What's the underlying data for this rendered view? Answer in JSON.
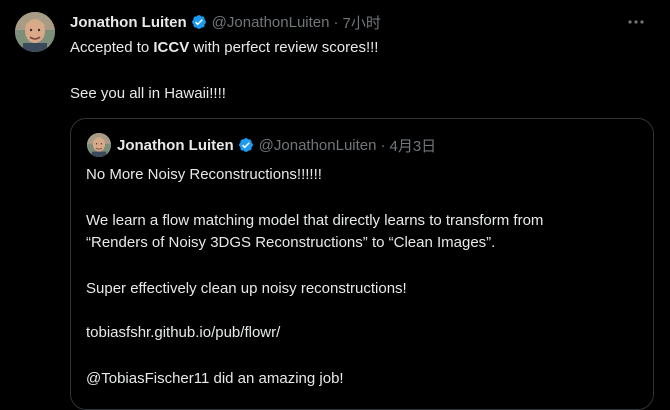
{
  "author": {
    "name": "Jonathon Luiten",
    "handle": "@JonathonLuiten",
    "time": "7小时"
  },
  "post": {
    "line1_before": "Accepted to ",
    "line1_bold": "ICCV",
    "line1_after": " with perfect review scores!!!",
    "line2": "See you all in Hawaii!!!!"
  },
  "quoted": {
    "name": "Jonathon Luiten",
    "handle": "@JonathonLuiten",
    "date": "4月3日",
    "lines": [
      "No More Noisy Reconstructions!!!!!!",
      "We learn a flow matching model that directly learns to transform from",
      "“Renders of Noisy 3DGS Reconstructions” to “Clean Images”.",
      "Super effectively clean up noisy reconstructions!",
      "tobiasfshr.github.io/pub/flowr/",
      "@TobiasFischer11 did an amazing job!"
    ]
  },
  "icons": {
    "verified": "verified-badge-icon",
    "more": "more-options-icon"
  },
  "colors": {
    "background": "#000000",
    "text": "#e7e9ea",
    "muted": "#71767b",
    "verified": "#1d9bf0",
    "border": "#2f3336"
  }
}
